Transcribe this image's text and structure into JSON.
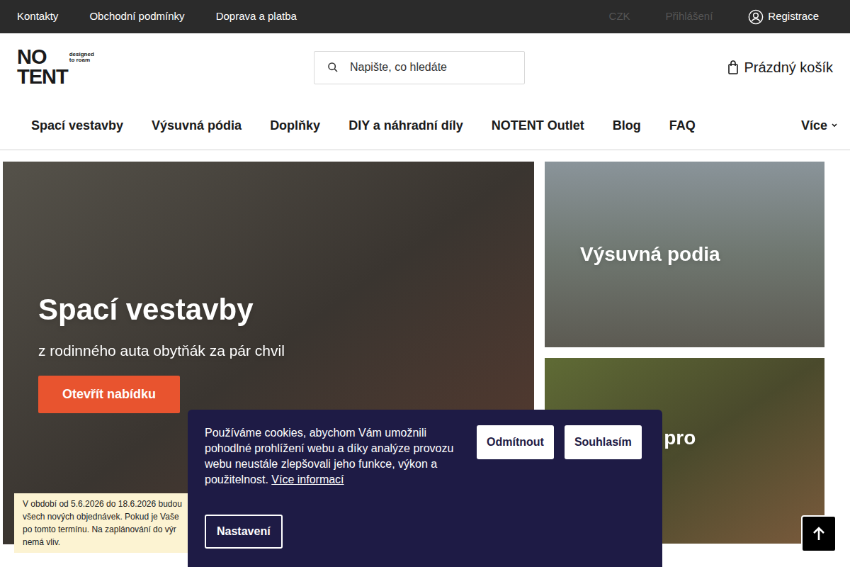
{
  "topbar": {
    "links": [
      "Kontakty",
      "Obchodní podmínky",
      "Doprava a platba"
    ],
    "currency": "CZK",
    "login": "Přihlášení",
    "register": "Registrace"
  },
  "logo": {
    "line1": "NO",
    "line2": "TENT",
    "tagline": "designed to roam"
  },
  "search": {
    "placeholder": "Napište, co hledáte"
  },
  "cart": {
    "label": "Prázdný košík"
  },
  "nav": {
    "items": [
      "Spací vestavby",
      "Výsuvná pódia",
      "Doplňky",
      "DIY a náhradní díly",
      "NOTENT Outlet",
      "Blog",
      "FAQ"
    ],
    "more": "Více"
  },
  "hero": {
    "main": {
      "title": "Spací vestavby",
      "subtitle": "z rodinného auta obytňák za pár chvil",
      "button": "Otevřít nabídku"
    },
    "tiles": [
      {
        "title": "Výsuvná podia"
      },
      {
        "title": "Doplňky pro spaní"
      }
    ]
  },
  "notice": {
    "lines": [
      "V období od 5.6.2026 do 18.6.2026 budou",
      "všech nových objednávek. Pokud je Vaše",
      "po tomto termínu. Na zaplánování do výr",
      "nemá vliv."
    ]
  },
  "cookie": {
    "text": "Používáme cookies, abychom Vám umožnili pohodlné prohlížení webu a díky analýze provozu webu neustále zlepšovali jeho funkce, výkon a použitelnost.",
    "link": "Více informací",
    "buttons": [
      "Odmítnout",
      "Souhlasím"
    ],
    "settings": "Nastavení"
  }
}
